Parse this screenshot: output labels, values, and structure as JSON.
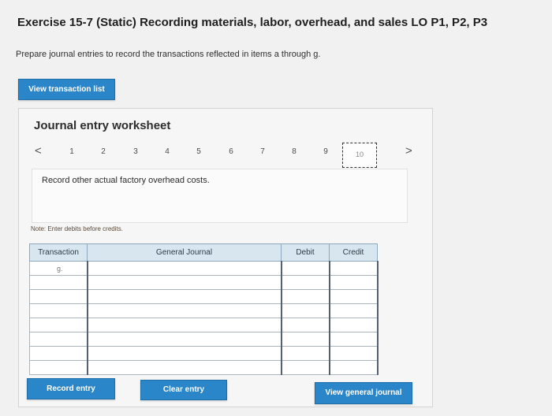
{
  "exercise": {
    "title": "Exercise 15-7 (Static) Recording materials, labor, overhead, and sales LO P1, P2, P3",
    "instructions": "Prepare journal entries to record the transactions reflected in items a through g."
  },
  "buttons": {
    "view_transaction_list": "View transaction list",
    "record_entry": "Record entry",
    "clear_entry": "Clear entry",
    "view_general_journal": "View general journal"
  },
  "worksheet": {
    "title": "Journal entry worksheet",
    "pages": [
      "1",
      "2",
      "3",
      "4",
      "5",
      "6",
      "7",
      "8",
      "9"
    ],
    "active_page": "10",
    "prev_arrow": "<",
    "next_arrow": ">",
    "description": "Record other actual factory overhead costs.",
    "note": "Note: Enter debits before credits."
  },
  "journal": {
    "headers": {
      "transaction": "Transaction",
      "general_journal": "General Journal",
      "debit": "Debit",
      "credit": "Credit"
    },
    "rows": [
      {
        "transaction": "g.",
        "account": "",
        "debit": "",
        "credit": ""
      },
      {
        "transaction": "",
        "account": "",
        "debit": "",
        "credit": ""
      },
      {
        "transaction": "",
        "account": "",
        "debit": "",
        "credit": ""
      },
      {
        "transaction": "",
        "account": "",
        "debit": "",
        "credit": ""
      },
      {
        "transaction": "",
        "account": "",
        "debit": "",
        "credit": ""
      },
      {
        "transaction": "",
        "account": "",
        "debit": "",
        "credit": ""
      },
      {
        "transaction": "",
        "account": "",
        "debit": "",
        "credit": ""
      },
      {
        "transaction": "",
        "account": "",
        "debit": "",
        "credit": ""
      }
    ]
  },
  "colors": {
    "button_blue": "#2a86c9",
    "table_header": "#d8e6ef"
  }
}
